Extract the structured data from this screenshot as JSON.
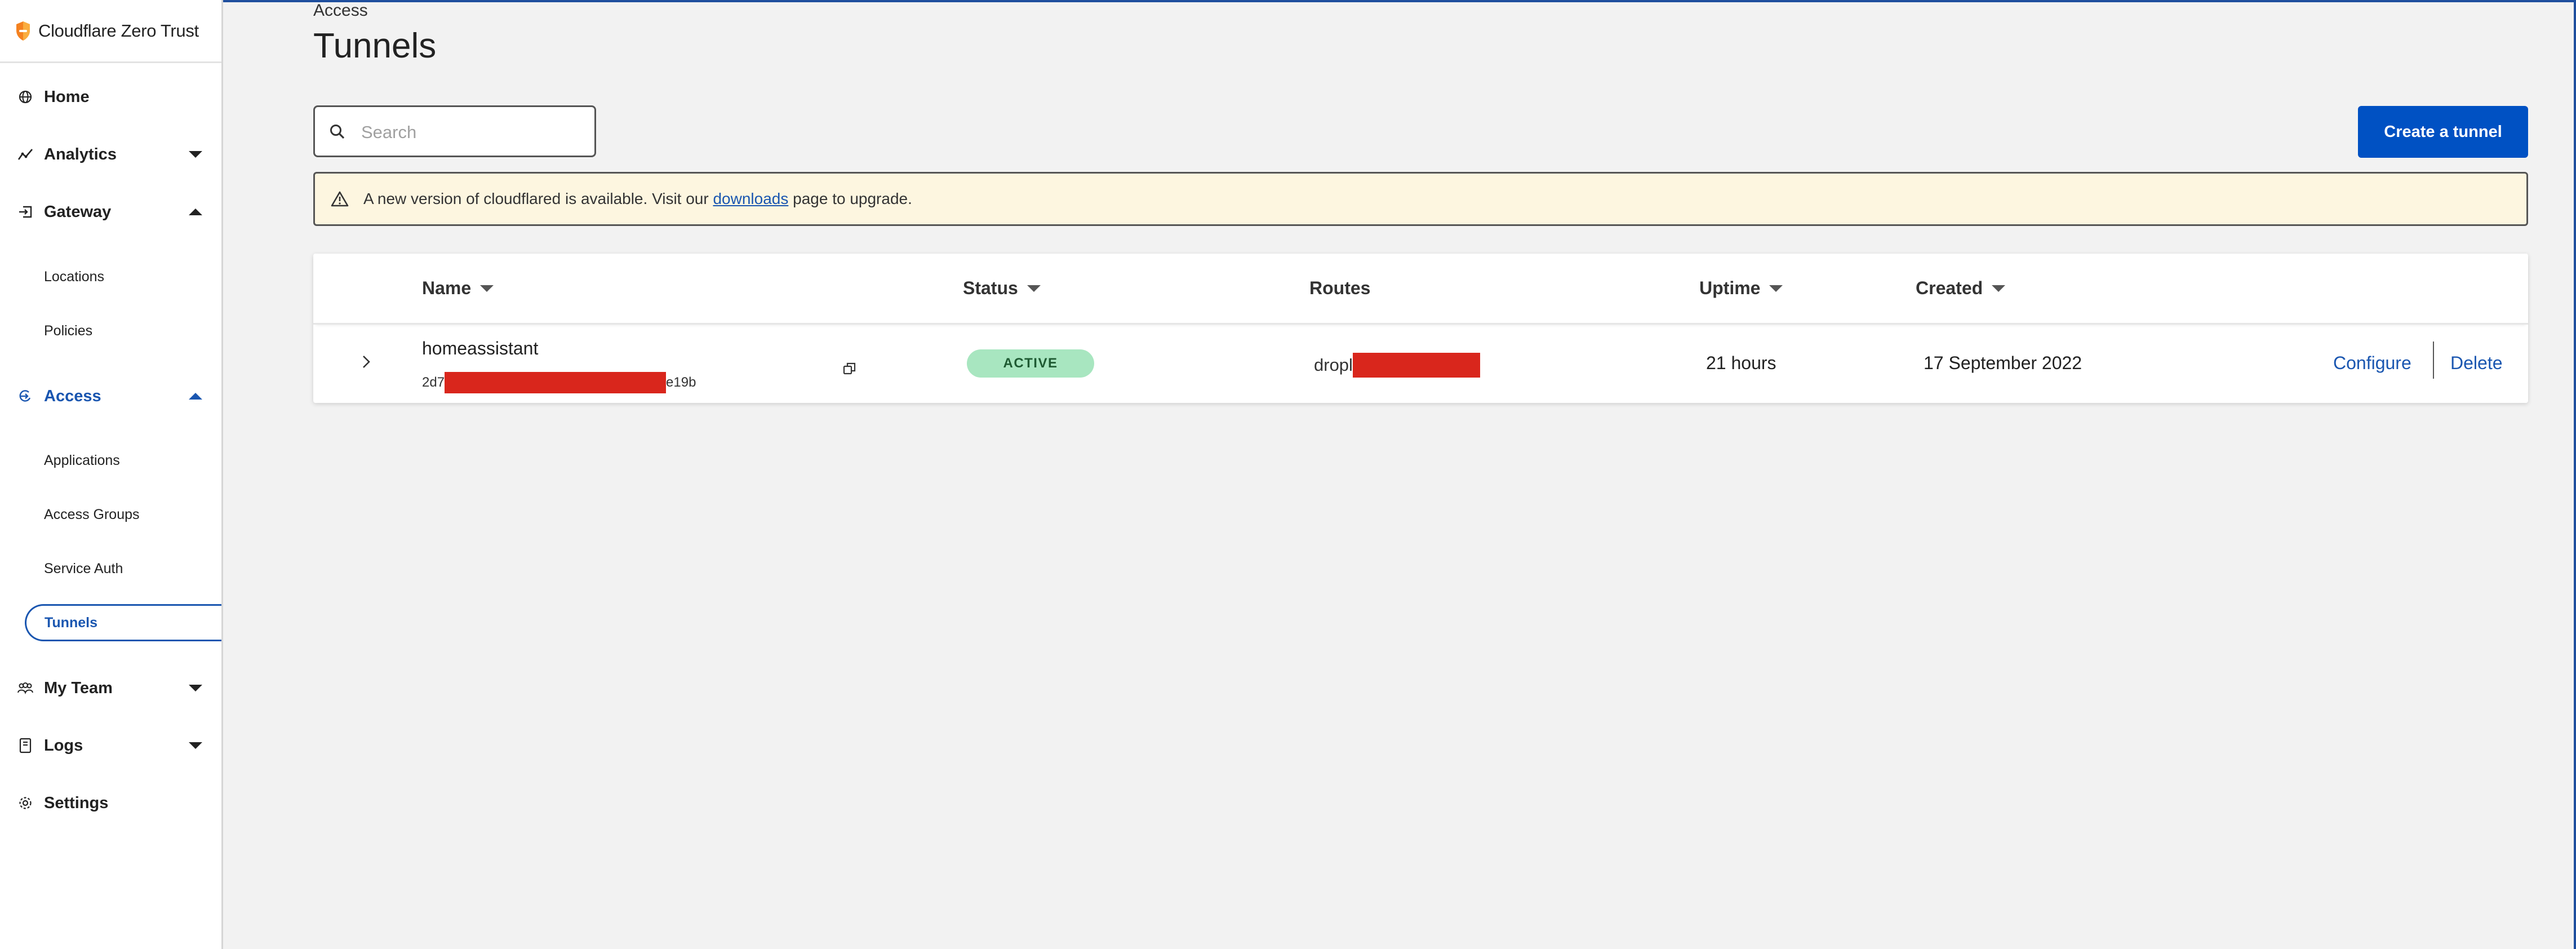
{
  "app": {
    "title": "Cloudflare Zero Trust"
  },
  "sidebar": {
    "home": "Home",
    "analytics": "Analytics",
    "gateway": "Gateway",
    "gateway_items": [
      "Locations",
      "Policies"
    ],
    "access": "Access",
    "access_items": [
      "Applications",
      "Access Groups",
      "Service Auth",
      "Tunnels"
    ],
    "my_team": "My Team",
    "logs": "Logs",
    "settings": "Settings"
  },
  "page": {
    "breadcrumb": "Access",
    "title": "Tunnels"
  },
  "search": {
    "placeholder": "Search",
    "value": ""
  },
  "create_button": "Create a tunnel",
  "banner": {
    "text_before": "A new version of cloudflared is available. Visit our ",
    "link": "downloads",
    "text_after": " page to upgrade."
  },
  "table": {
    "headers": {
      "name": "Name",
      "status": "Status",
      "routes": "Routes",
      "uptime": "Uptime",
      "created": "Created"
    },
    "rows": [
      {
        "name": "homeassistant",
        "id_prefix": "2d7",
        "id_suffix": "e19b",
        "status": "ACTIVE",
        "route_prefix": "dropl",
        "uptime": "21 hours",
        "created": "17 September 2022",
        "configure": "Configure",
        "delete": "Delete"
      }
    ]
  },
  "colors": {
    "accent": "#0051c3",
    "link": "#1a56b0",
    "active_badge": "#a8e6c0",
    "redaction": "#d9261c",
    "banner_bg": "#fdf6e0"
  }
}
